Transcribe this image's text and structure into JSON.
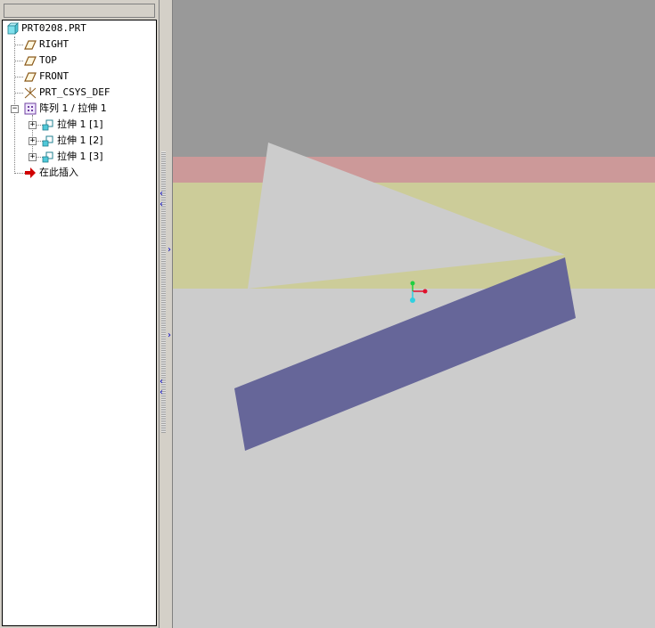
{
  "tree": {
    "root": {
      "label": "PRT0208.PRT",
      "icon": "part-icon"
    },
    "items": [
      {
        "label": "RIGHT",
        "icon": "datum-plane-icon"
      },
      {
        "label": "TOP",
        "icon": "datum-plane-icon"
      },
      {
        "label": "FRONT",
        "icon": "datum-plane-icon"
      },
      {
        "label": "PRT_CSYS_DEF",
        "icon": "coordinate-system-icon"
      }
    ],
    "pattern": {
      "label": "阵列 1 / 拉伸 1",
      "icon": "pattern-icon",
      "expander": "−",
      "children": [
        {
          "label": "拉伸 1 [1]",
          "icon": "extrude-icon",
          "expander": "+"
        },
        {
          "label": "拉伸 1 [2]",
          "icon": "extrude-icon",
          "expander": "+"
        },
        {
          "label": "拉伸 1 [3]",
          "icon": "extrude-icon",
          "expander": "+"
        }
      ]
    },
    "insert_here": {
      "label": "在此插入",
      "icon": "insert-arrow-icon"
    }
  },
  "sash": {
    "arrows": [
      "‹",
      "‹",
      "›",
      "›",
      "‹",
      "‹"
    ]
  },
  "colors": {
    "viewport_background": "#cccccc",
    "band_gray": "#999999",
    "band_pink": "#cc9999",
    "band_yellow": "#cccc99",
    "triangle": "#cccccc",
    "bar": "#666699",
    "csys_x": "#e0102c",
    "csys_y": "#20d040",
    "csys_z": "#30d0e0"
  }
}
